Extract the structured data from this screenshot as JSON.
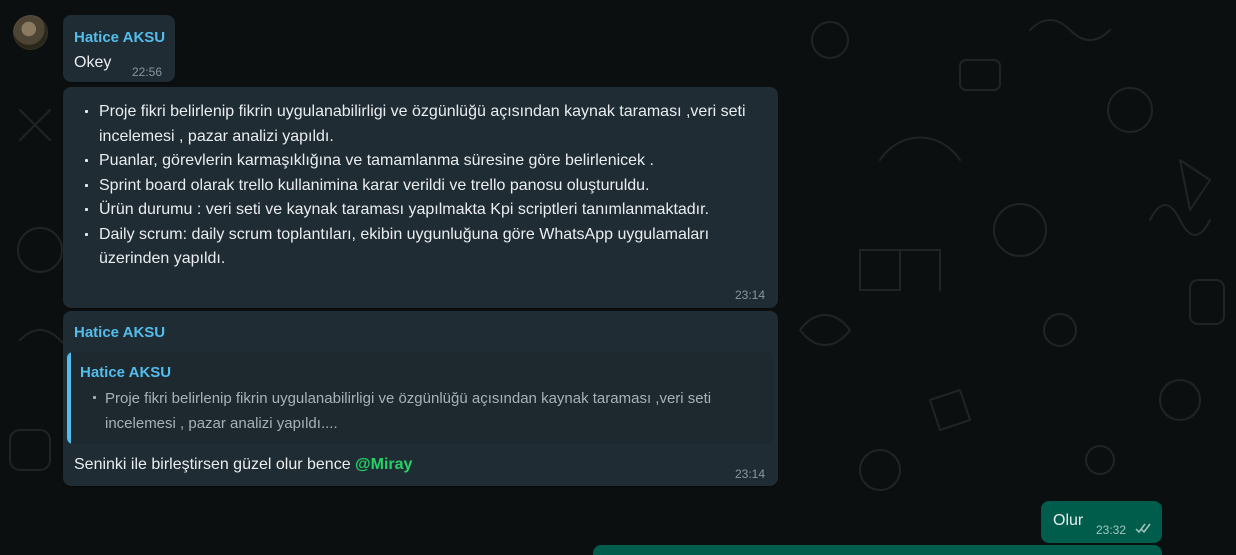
{
  "messages": [
    {
      "sender": "Hatice AKSU",
      "text": "Okey",
      "time": "22:56"
    },
    {
      "items": [
        "Proje fikri belirlenip fikrin uygulanabilirligi ve özgünlüğü açısından kaynak taraması ,veri seti incelemesi , pazar analizi yapıldı.",
        "Puanlar, görevlerin karmaşıklığına ve tamamlanma süresine göre belirlenicek .",
        "Sprint board olarak trello kullanimina karar verildi ve trello panosu oluşturuldu.",
        "Ürün durumu : veri seti ve kaynak taraması yapılmakta Kpi scriptleri tanımlanmaktadır.",
        "Daily scrum: daily scrum toplantıları, ekibin uygunluğuna göre WhatsApp uygulamaları üzerinden yapıldı."
      ],
      "time": "23:14"
    },
    {
      "sender": "Hatice AKSU",
      "quote": {
        "sender": "Hatice AKSU",
        "text": "Proje fikri belirlenip fikrin uygulanabilirligi ve özgünlüğü açısından kaynak taraması ,veri seti incelemesi , pazar analizi yapıldı...."
      },
      "text": "Seninki ile birleştirsen güzel olur bence ",
      "mention": "@Miray",
      "time": "23:14"
    },
    {
      "text": "Olur",
      "time": "23:32",
      "status": "read-double-check-icon"
    }
  ],
  "colors": {
    "incoming": "#202c33",
    "outgoing": "#005c4b",
    "sender": "#53bdeb",
    "mention": "#25d366",
    "read": "#8696a0"
  }
}
